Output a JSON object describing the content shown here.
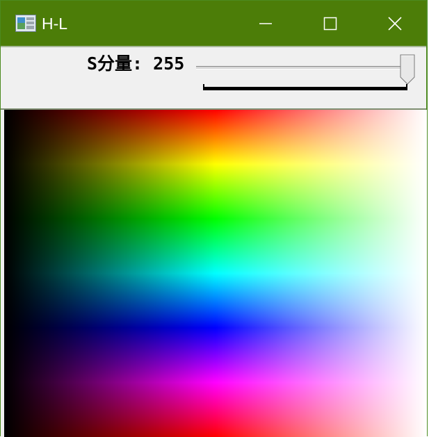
{
  "window": {
    "title": "H-L",
    "titlebar_color": "#4c7d08",
    "icons": {
      "app": "app-image-icon",
      "minimize": "minimize-icon",
      "maximize": "maximize-icon",
      "close": "close-icon"
    }
  },
  "slider": {
    "label": "S分量: 255",
    "value": 255,
    "min": 0,
    "max": 255
  },
  "canvas": {
    "description_axis_vertical": "hue",
    "description_axis_horizontal": "lightness"
  }
}
